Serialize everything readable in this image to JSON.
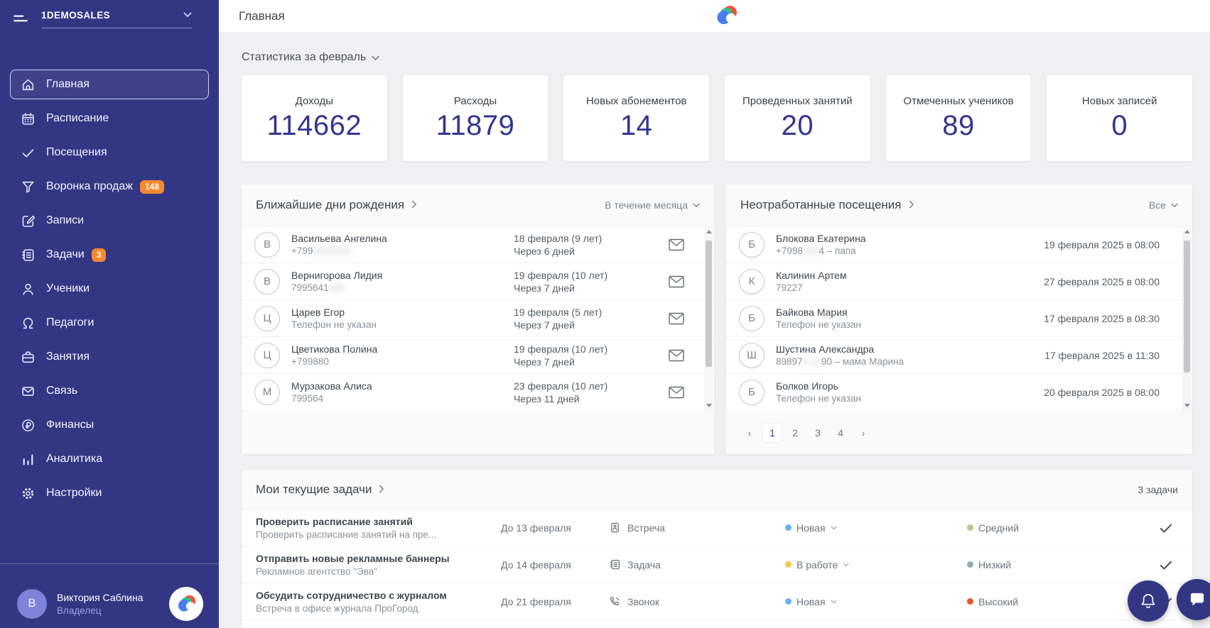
{
  "app": {
    "org_name": "1DEMOSALES",
    "page_title": "Главная"
  },
  "sidebar": {
    "items": [
      {
        "label": "Главная"
      },
      {
        "label": "Расписание"
      },
      {
        "label": "Посещения"
      },
      {
        "label": "Воронка продаж",
        "badge": "148"
      },
      {
        "label": "Записи"
      },
      {
        "label": "Задачи",
        "badge": "3"
      },
      {
        "label": "Ученики"
      },
      {
        "label": "Педагоги"
      },
      {
        "label": "Занятия"
      },
      {
        "label": "Связь"
      },
      {
        "label": "Финансы"
      },
      {
        "label": "Аналитика"
      },
      {
        "label": "Настройки"
      }
    ],
    "user": {
      "initial": "В",
      "name": "Виктория Саблина",
      "role": "Владелец"
    }
  },
  "stats": {
    "title": "Статистика за февраль",
    "cards": [
      {
        "label": "Доходы",
        "value": "114662"
      },
      {
        "label": "Расходы",
        "value": "11879"
      },
      {
        "label": "Новых абонементов",
        "value": "14"
      },
      {
        "label": "Проведенных занятий",
        "value": "20"
      },
      {
        "label": "Отмеченных учеников",
        "value": "89"
      },
      {
        "label": "Новых записей",
        "value": "0"
      }
    ]
  },
  "birthdays": {
    "title": "Ближайшие дни рождения",
    "filter": "В течение месяца",
    "rows": [
      {
        "initial": "В",
        "name": "Васильева Ангелина",
        "phone": "+799",
        "phone_redacted": "0000000",
        "phone_suffix": "",
        "date": "18 февраля (9 лет)",
        "when": "Через 6 дней"
      },
      {
        "initial": "В",
        "name": "Вернигорова Лидия",
        "phone": "7995641",
        "phone_redacted": "000",
        "phone_suffix": "",
        "date": "19 февраля (10 лет)",
        "when": "Через 7 дней"
      },
      {
        "initial": "Ц",
        "name": "Царев Егор",
        "phone": "Телефон не указан",
        "phone_redacted": "",
        "phone_suffix": "",
        "date": "19 февраля (5 лет)",
        "when": "Через 7 дней"
      },
      {
        "initial": "Ц",
        "name": "Цветикова Полина",
        "phone": "+799880",
        "phone_redacted": "",
        "phone_suffix": "",
        "date": "19 февраля (10 лет)",
        "when": "Через 7 дней"
      },
      {
        "initial": "М",
        "name": "Мурзакова Алиса",
        "phone": "799564",
        "phone_redacted": "",
        "phone_suffix": "",
        "date": "23 февраля (10 лет)",
        "when": "Через 11 дней"
      }
    ]
  },
  "visits": {
    "title": "Неотработанные посещения",
    "filter": "Все",
    "rows": [
      {
        "initial": "Б",
        "name": "Блокова Екатерина",
        "phone": "+7998",
        "phone_redacted": "000",
        "phone_suffix": "4 – папа",
        "date": "19 февраля 2025 в 08:00"
      },
      {
        "initial": "К",
        "name": "Калинин Артем",
        "phone": "79227",
        "phone_redacted": "",
        "phone_suffix": "",
        "date": "27 февраля 2025 в 08:00"
      },
      {
        "initial": "Б",
        "name": "Байкова Мария",
        "phone": "Телефон не указан",
        "phone_redacted": "",
        "phone_suffix": "",
        "date": "17 февраля 2025 в 08:30"
      },
      {
        "initial": "Ш",
        "name": "Шустина Александра",
        "phone": "89897",
        "phone_redacted": "0 10",
        "phone_suffix": "90 – мама Марина",
        "date": "17 февраля 2025 в 11:30"
      },
      {
        "initial": "Б",
        "name": "Болков Игорь",
        "phone": "Телефон не указан",
        "phone_redacted": "",
        "phone_suffix": "",
        "date": "20 февраля 2025 в 08:00"
      }
    ],
    "pagination": {
      "prev": "‹",
      "pages": [
        "1",
        "2",
        "3",
        "4"
      ],
      "next": "›",
      "active": "1"
    }
  },
  "tasks": {
    "title": "Мои текущие задачи",
    "count": "3 задачи",
    "rows": [
      {
        "title": "Проверить расписание занятий",
        "subtitle": "Проверить расписание занятий на пре...",
        "due": "До 13 февраля",
        "type": "Встреча",
        "status": "Новая",
        "status_color": "#69b1f1",
        "priority": "Средний",
        "priority_color": "#a8cd8c"
      },
      {
        "title": "Отправить новые рекламные баннеры",
        "subtitle": "Рекламное агентство \"Эва\"",
        "due": "До 14 февраля",
        "type": "Задача",
        "status": "В работе",
        "status_color": "#f5c84b",
        "priority": "Низкий",
        "priority_color": "#93a9b4"
      },
      {
        "title": "Обсудить сотрудничество с журналом",
        "subtitle": "Встреча в офисе журнала ПроГород",
        "due": "До 21 февраля",
        "type": "Звонок",
        "status": "Новая",
        "status_color": "#69b1f1",
        "priority": "Высокий",
        "priority_color": "#e2552f"
      }
    ]
  },
  "colors": {
    "sidebar": "#333783",
    "accent": "#32368f",
    "badge": "#f6892f",
    "logo_blue": "#4a7df0",
    "logo_green": "#2fbf8f",
    "logo_red": "#f4503a"
  }
}
